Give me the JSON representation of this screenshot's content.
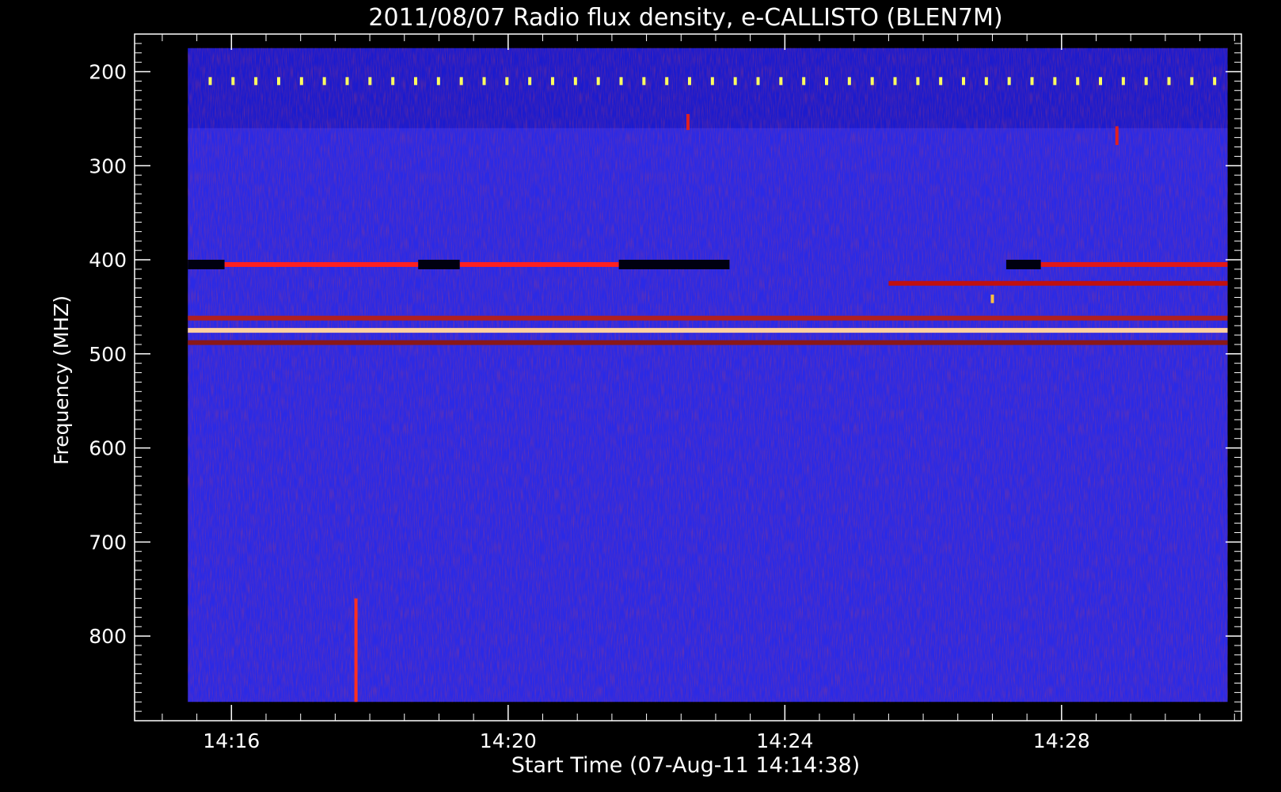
{
  "chart_data": {
    "type": "heatmap",
    "title": "2011/08/07  Radio flux density, e-CALLISTO (BLEN7M)",
    "xlabel": "Start Time (07-Aug-11 14:14:38)",
    "ylabel": "Frequency (MHZ)",
    "x_tick_labels": [
      "14:16",
      "14:20",
      "14:24",
      "14:28"
    ],
    "x_ticks_minutes": [
      16,
      20,
      24,
      28
    ],
    "y_tick_labels": [
      "200",
      "300",
      "400",
      "500",
      "600",
      "700",
      "800"
    ],
    "y_ticks": [
      200,
      300,
      400,
      500,
      600,
      700,
      800
    ],
    "x_range_minutes": [
      14.6,
      30.6
    ],
    "data_time_range_minutes": [
      15.37,
      30.4
    ],
    "y_range": [
      160,
      890
    ],
    "data_freq_range": [
      175,
      870
    ],
    "y_inverted": true,
    "colors": {
      "background": "#000000",
      "low": "#0000a0",
      "mid": "#2a2ae6",
      "high": "#c81010",
      "peak": "#ffff60",
      "frame": "#ffffff"
    },
    "features": [
      {
        "type": "band",
        "freq": 405,
        "t0": 15.9,
        "t1": 18.7,
        "color": "#ff2020"
      },
      {
        "type": "band",
        "freq": 405,
        "t0": 19.3,
        "t1": 21.6,
        "color": "#ff2020"
      },
      {
        "type": "band",
        "freq": 405,
        "t0": 27.7,
        "t1": 30.4,
        "color": "#e01818"
      },
      {
        "type": "band",
        "freq": 425,
        "t0": 25.5,
        "t1": 30.4,
        "color": "#c01010"
      },
      {
        "type": "band",
        "freq": 475,
        "t0": 15.37,
        "t1": 30.4,
        "color": "#ffd0a0"
      },
      {
        "type": "band",
        "freq": 462,
        "t0": 15.37,
        "t1": 30.4,
        "color": "#b02020"
      },
      {
        "type": "band",
        "freq": 488,
        "t0": 15.37,
        "t1": 30.4,
        "color": "#8a1818"
      },
      {
        "type": "dark",
        "freq": 405,
        "t0": 15.37,
        "t1": 15.9
      },
      {
        "type": "dark",
        "freq": 405,
        "t0": 18.7,
        "t1": 19.3
      },
      {
        "type": "dark",
        "freq": 405,
        "t0": 21.6,
        "t1": 23.2
      },
      {
        "type": "dark",
        "freq": 405,
        "t0": 27.2,
        "t1": 27.7
      },
      {
        "type": "burst",
        "time": 17.8,
        "f0": 760,
        "f1": 870,
        "color": "#ff3020"
      },
      {
        "type": "burst",
        "time": 22.6,
        "f0": 245,
        "f1": 262,
        "color": "#e02020"
      },
      {
        "type": "burst",
        "time": 28.8,
        "f0": 258,
        "f1": 278,
        "color": "#e02020"
      },
      {
        "type": "burst",
        "time": 27.0,
        "f0": 437,
        "f1": 446,
        "color": "#ffc040"
      }
    ]
  }
}
